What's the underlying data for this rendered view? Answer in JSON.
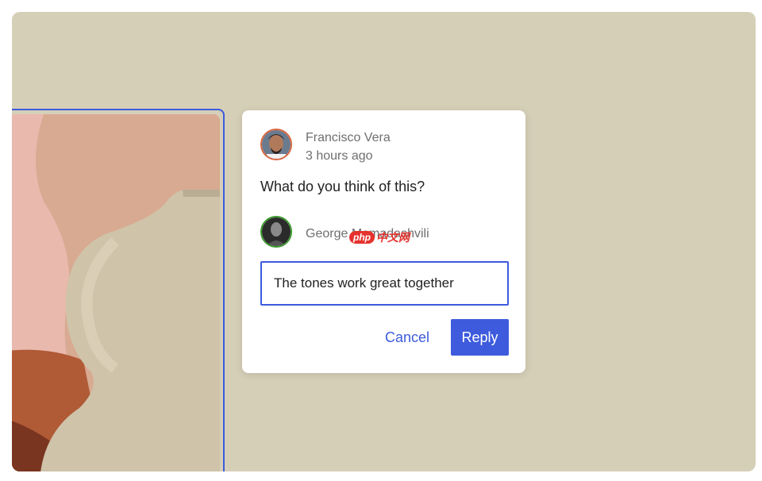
{
  "comment": {
    "author": "Francisco Vera",
    "time": "3 hours ago",
    "text": "What do you think of this?",
    "avatar_ring_color": "#d9663f"
  },
  "reply": {
    "author": "George Mamadashvili",
    "avatar_ring_color": "#3c9a2e",
    "input_value": "The tones work great together",
    "cancel_label": "Cancel",
    "submit_label": "Reply"
  },
  "watermark": {
    "badge": "php",
    "text": "中文网"
  },
  "colors": {
    "accent": "#3d5bdc",
    "canvas": "#d6cfb8"
  }
}
